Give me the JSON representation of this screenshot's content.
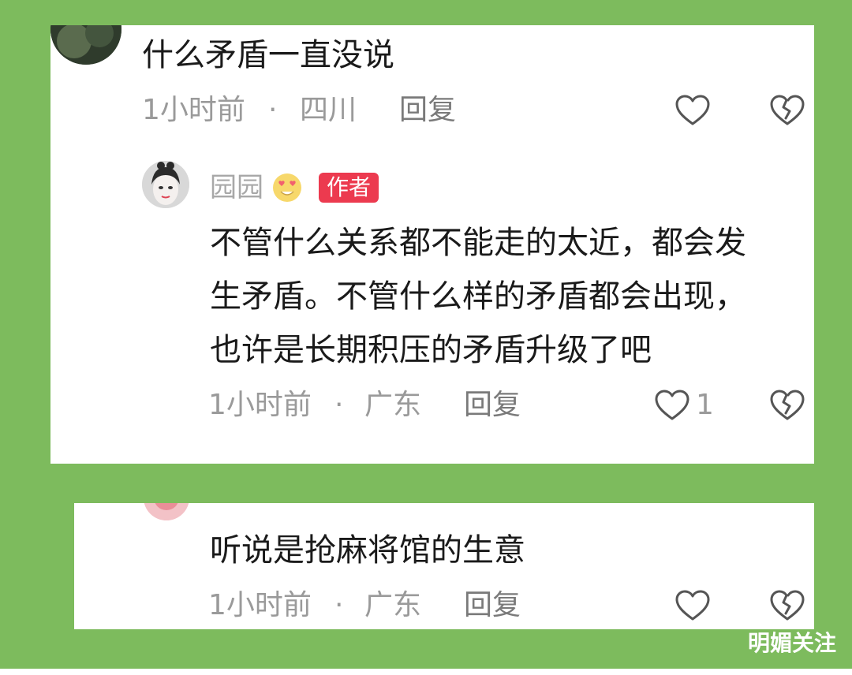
{
  "comment1": {
    "text": "什么矛盾一直没说",
    "time": "1小时前",
    "location": "四川",
    "reply_label": "回复",
    "like_icon": "heart-outline-icon",
    "dislike_icon": "broken-heart-icon"
  },
  "reply1": {
    "username": "园园",
    "name_emoji": "heart-eyes-emoji",
    "author_badge": "作者",
    "text_lines": [
      "不管什么关系都不能走的太近，都会发",
      "生矛盾。不管什么样的矛盾都会出现，",
      "也许是长期积压的矛盾升级了吧"
    ],
    "time": "1小时前",
    "location": "广东",
    "reply_label": "回复",
    "like_count": "1"
  },
  "comment2": {
    "text": "听说是抢麻将馆的生意",
    "time": "1小时前",
    "location": "广东",
    "reply_label": "回复"
  },
  "separator": "·",
  "watermark": "明媚关注",
  "colors": {
    "background_green": "#7dbb5d",
    "card_white": "#ffffff",
    "author_badge_red": "#ec3a4f",
    "meta_gray": "#9a9a9a"
  }
}
